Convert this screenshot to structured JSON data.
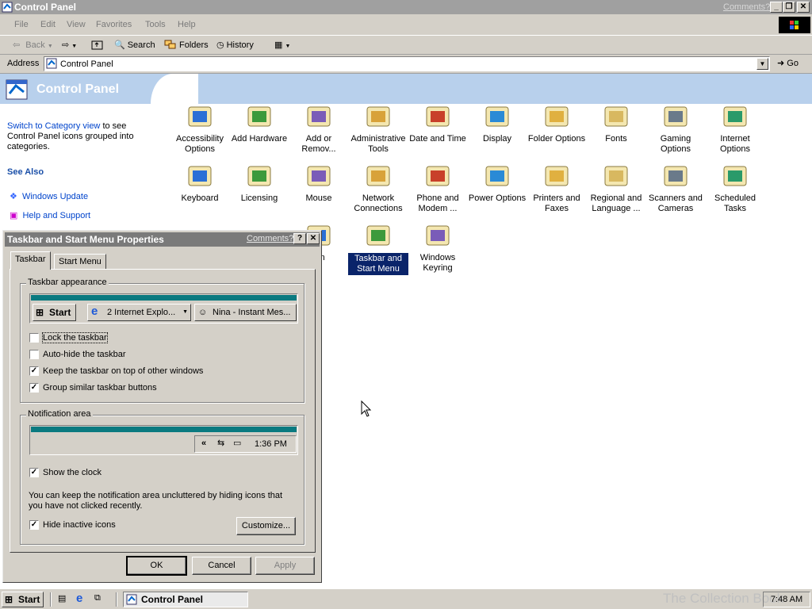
{
  "window": {
    "title": "Control Panel",
    "comments_link": "Comments?",
    "menu": [
      "File",
      "Edit",
      "View",
      "Favorites",
      "Tools",
      "Help"
    ],
    "toolbar": {
      "back": "Back",
      "search": "Search",
      "folders": "Folders",
      "history": "History"
    },
    "address": {
      "label": "Address",
      "value": "Control Panel",
      "go": "Go"
    }
  },
  "panel": {
    "heading": "Control Panel",
    "switch_link": "Switch to Category view",
    "switch_text": " to see Control Panel icons grouped into categories.",
    "see_also": "See Also",
    "see_also_items": [
      "Windows Update",
      "Help and Support"
    ]
  },
  "icons": [
    {
      "label": "Accessibility Options",
      "icon": "accessibility-icon"
    },
    {
      "label": "Add Hardware",
      "icon": "add-hardware-icon"
    },
    {
      "label": "Add or Remov...",
      "icon": "add-remove-programs-icon"
    },
    {
      "label": "Administrative Tools",
      "icon": "administrative-tools-icon"
    },
    {
      "label": "Date and Time",
      "icon": "date-time-icon"
    },
    {
      "label": "Display",
      "icon": "display-icon"
    },
    {
      "label": "Folder Options",
      "icon": "folder-options-icon"
    },
    {
      "label": "Fonts",
      "icon": "fonts-icon"
    },
    {
      "label": "Gaming Options",
      "icon": "gaming-options-icon"
    },
    {
      "label": "Internet Options",
      "icon": "internet-options-icon"
    },
    {
      "label": "Keyboard",
      "icon": "keyboard-icon"
    },
    {
      "label": "Licensing",
      "icon": "licensing-icon"
    },
    {
      "label": "Mouse",
      "icon": "mouse-icon"
    },
    {
      "label": "Network Connections",
      "icon": "network-connections-icon"
    },
    {
      "label": "Phone and Modem ...",
      "icon": "phone-modem-icon"
    },
    {
      "label": "Power Options",
      "icon": "power-options-icon"
    },
    {
      "label": "Printers and Faxes",
      "icon": "printers-faxes-icon"
    },
    {
      "label": "Regional and Language ...",
      "icon": "regional-language-icon"
    },
    {
      "label": "Scanners and Cameras",
      "icon": "scanners-cameras-icon"
    },
    {
      "label": "Scheduled Tasks",
      "icon": "scheduled-tasks-icon"
    },
    {
      "label": "em",
      "icon": "system-icon"
    },
    {
      "label": "Taskbar and Start Menu",
      "icon": "taskbar-start-menu-icon",
      "selected": true
    },
    {
      "label": "Windows Keyring",
      "icon": "windows-keyring-icon"
    }
  ],
  "dialog": {
    "title": "Taskbar and Start Menu Properties",
    "comments_link": "Comments?",
    "help": "?",
    "close": "✕",
    "tabs": [
      "Taskbar",
      "Start Menu"
    ],
    "appearance": {
      "group_label": "Taskbar appearance",
      "preview": {
        "start": "Start",
        "ie_button": "2 Internet Explo...",
        "im_button": "Nina - Instant Mes..."
      },
      "options": [
        {
          "label": "Lock the taskbar",
          "checked": false
        },
        {
          "label": "Auto-hide the taskbar",
          "checked": false
        },
        {
          "label": "Keep the taskbar on top of other windows",
          "checked": true
        },
        {
          "label": "Group similar taskbar buttons",
          "checked": true
        }
      ]
    },
    "notification": {
      "group_label": "Notification area",
      "preview_time": "1:36 PM",
      "preview_chevron": "«",
      "show_clock": {
        "label": "Show the clock",
        "checked": true
      },
      "description": "You can keep the notification area uncluttered by hiding icons that you have not clicked recently.",
      "hide_inactive": {
        "label": "Hide inactive icons",
        "checked": true
      },
      "customize": "Customize..."
    },
    "buttons": {
      "ok": "OK",
      "cancel": "Cancel",
      "apply": "Apply"
    }
  },
  "taskbar": {
    "start": "Start",
    "task": "Control Panel",
    "clock": "7:48 AM",
    "watermark": "The Collection Book"
  }
}
